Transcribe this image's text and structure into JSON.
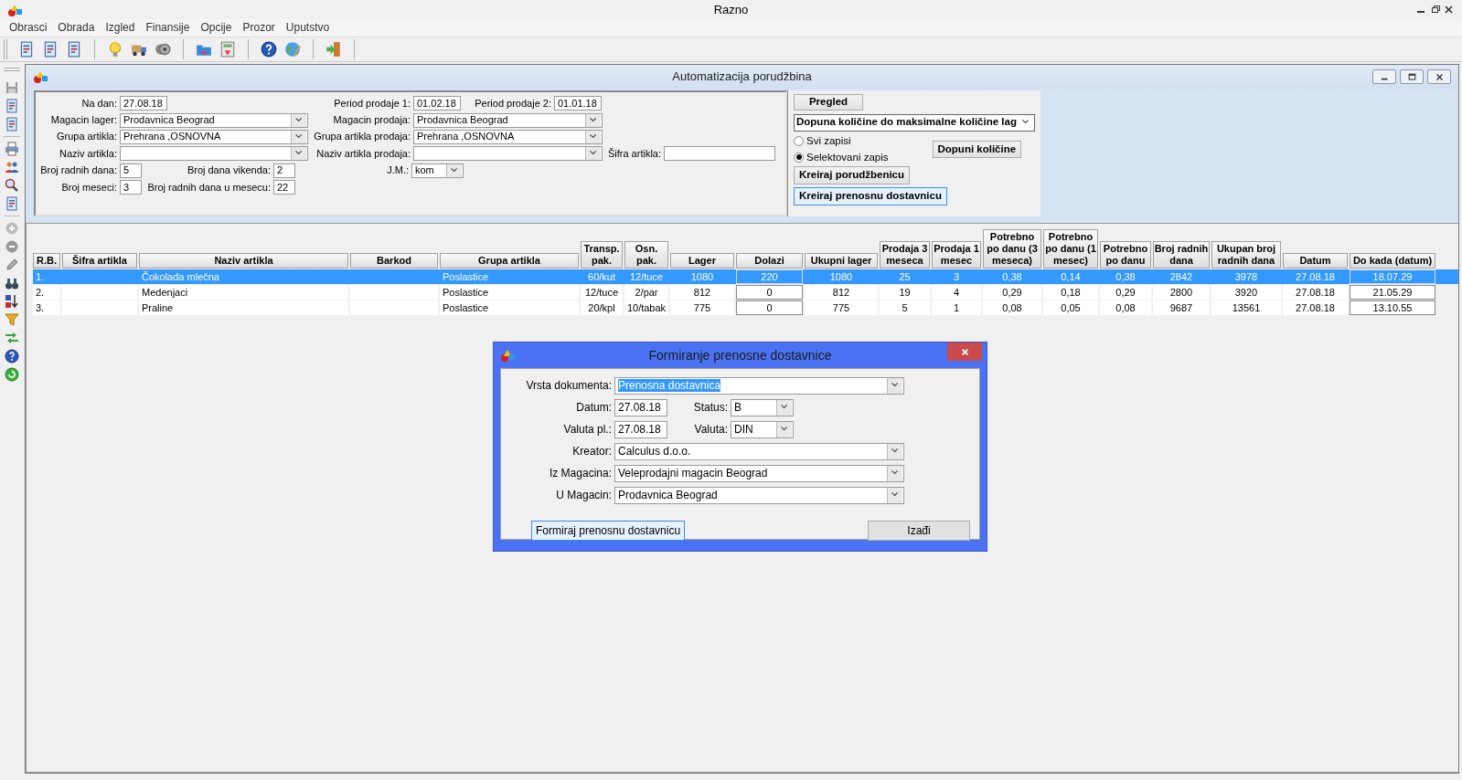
{
  "window": {
    "title": "Razno"
  },
  "menu": [
    "Obrasci",
    "Obrada",
    "Izgled",
    "Finansije",
    "Opcije",
    "Prozor",
    "Uputstvo"
  ],
  "child_window": {
    "title": "Automatizacija porudžbina"
  },
  "filters": [
    [
      {
        "label": "Na dan:",
        "kind": "text",
        "value": "27.08.18"
      },
      {
        "label": "Period prodaje 1:",
        "kind": "text",
        "value": "01.02.18"
      },
      {
        "label": "Period prodaje 2:",
        "kind": "text",
        "value": "01.01.18"
      }
    ],
    [
      {
        "label": "Magacin lager:",
        "kind": "combo",
        "value": "Prodavnica Beograd"
      },
      {
        "label": "Magacin prodaja:",
        "kind": "combo",
        "value": "Prodavnica Beograd"
      }
    ],
    [
      {
        "label": "Grupa artikla:",
        "kind": "combo",
        "value": "Prehrana ,OSNOVNA"
      },
      {
        "label": "Grupa artikla prodaja:",
        "kind": "combo",
        "value": "Prehrana ,OSNOVNA"
      }
    ],
    [
      {
        "label": "Naziv artikla:",
        "kind": "combo"
      },
      {
        "label": "Naziv artikla prodaja:",
        "kind": "combo"
      },
      {
        "label": "Šifra artikla:",
        "kind": "text"
      }
    ],
    [
      {
        "label": "Broj radnih dana:",
        "kind": "text",
        "value": "5"
      },
      {
        "label": "Broj dana vikenda:",
        "kind": "text",
        "value": "2"
      },
      {
        "label": "J.M.:",
        "kind": "combo",
        "value": "kom"
      }
    ],
    [
      {
        "label": "Broj meseci:",
        "kind": "text",
        "value": "3"
      },
      {
        "label": "Broj radnih dana u mesecu:",
        "kind": "text",
        "value": "22"
      }
    ]
  ],
  "actions": {
    "preview_button": "Pregled",
    "mode": "Dopuna količine do maksimalne količine lag",
    "scope": [
      {
        "label": "Svi zapisi",
        "selected": false
      },
      {
        "label": "Selektovani zapis",
        "selected": true
      }
    ],
    "fill_button": "Dopuni količine",
    "buttons": [
      {
        "label": "Kreiraj porudžbenicu",
        "focused": false
      },
      {
        "label": "Kreiraj prenosnu dostavnicu",
        "focused": true
      }
    ]
  },
  "table": {
    "columns": [
      {
        "label": "R.B.",
        "kind": "text"
      },
      {
        "label": "Šifra artikla",
        "kind": "text"
      },
      {
        "label": "Naziv artikla",
        "kind": "text"
      },
      {
        "label": "Barkod",
        "kind": "text"
      },
      {
        "label": "Grupa artikla",
        "kind": "text"
      },
      {
        "label": "Transp. pak.",
        "kind": "number"
      },
      {
        "label": "Osn. pak.",
        "kind": "number"
      },
      {
        "label": "Lager",
        "kind": "number"
      },
      {
        "label": "Dolazi",
        "kind": "input"
      },
      {
        "label": "Ukupni lager",
        "kind": "number"
      },
      {
        "label": "Prodaja 3 meseca",
        "kind": "number"
      },
      {
        "label": "Prodaja 1 mesec",
        "kind": "number"
      },
      {
        "label": "Potrebno po danu (3 meseca)",
        "kind": "number"
      },
      {
        "label": "Potrebno po danu (1 mesec)",
        "kind": "number"
      },
      {
        "label": "Potrebno po danu",
        "kind": "number"
      },
      {
        "label": "Broj radnih dana",
        "kind": "number"
      },
      {
        "label": "Ukupan broj radnih dana",
        "kind": "number"
      },
      {
        "label": "Datum",
        "kind": "number"
      },
      {
        "label": "Do kada (datum)",
        "kind": "input"
      }
    ],
    "rows": [
      {
        "selected": true,
        "cells": [
          "1.",
          null,
          "Čokolada mlečna",
          null,
          "Poslastice",
          "60/kut",
          "12/tuce",
          "1080",
          "220",
          "1080",
          "25",
          "3",
          "0,38",
          "0,14",
          "0,38",
          "2842",
          "3978",
          "27.08.18",
          "18.07.29"
        ]
      },
      {
        "selected": false,
        "cells": [
          "2.",
          null,
          "Medenjaci",
          null,
          "Poslastice",
          "12/tuce",
          "2/par",
          "812",
          "0",
          "812",
          "19",
          "4",
          "0,29",
          "0,18",
          "0,29",
          "2800",
          "3920",
          "27.08.18",
          "21.05.29"
        ]
      },
      {
        "selected": false,
        "cells": [
          "3.",
          null,
          "Praline",
          null,
          "Poslastice",
          "20/kpl",
          "10/tabak",
          "775",
          "0",
          "775",
          "5",
          "1",
          "0,08",
          "0,05",
          "0,08",
          "9687",
          "13561",
          "27.08.18",
          "13.10.55"
        ]
      }
    ]
  },
  "dialog": {
    "title": "Formiranje prenosne dostavnice",
    "rows": [
      [
        {
          "label": "Vrsta dokumenta:",
          "kind": "combo",
          "value": "Prenosna dostavnica",
          "highlighted": true
        }
      ],
      [
        {
          "label": "Datum:",
          "kind": "text",
          "value": "27.08.18",
          "highlighted": false
        },
        {
          "label": "Status:",
          "kind": "combo",
          "value": "B",
          "highlighted": false
        }
      ],
      [
        {
          "label": "Valuta pl.:",
          "kind": "text",
          "value": "27.08.18",
          "highlighted": false
        },
        {
          "label": "Valuta:",
          "kind": "combo",
          "value": "DIN",
          "highlighted": false
        }
      ],
      [
        {
          "label": "Kreator:",
          "kind": "combo",
          "value": "Calculus d.o.o.",
          "highlighted": false
        }
      ],
      [
        {
          "label": "Iz Magacina:",
          "kind": "combo",
          "value": "Veleprodajni magacin Beograd",
          "highlighted": false
        }
      ],
      [
        {
          "label": "U Magacin:",
          "kind": "combo",
          "value": "Prodavnica Beograd",
          "highlighted": false
        }
      ]
    ],
    "buttons": [
      {
        "label": "Formiraj prenosnu dostavnicu",
        "focused": true
      },
      {
        "label": "Izađi",
        "focused": false
      }
    ]
  }
}
